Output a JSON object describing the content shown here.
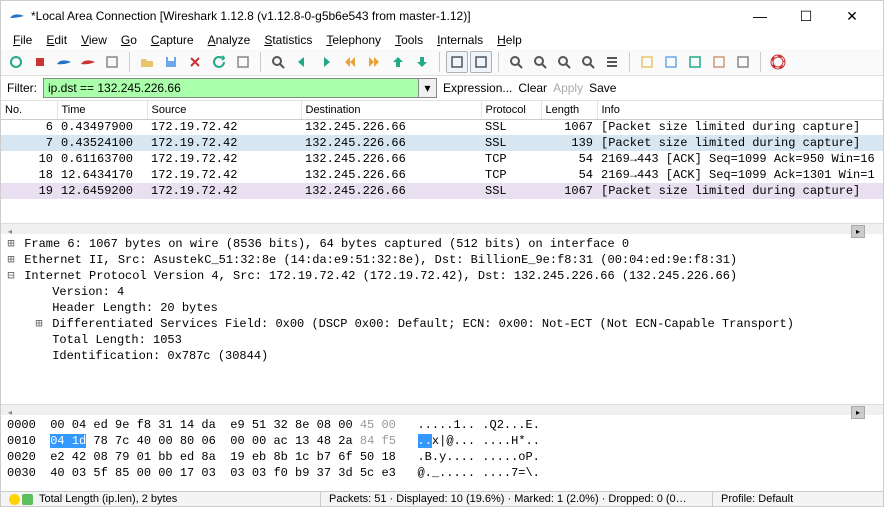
{
  "window": {
    "title": "*Local Area Connection   [Wireshark 1.12.8  (v1.12.8-0-g5b6e543 from master-1.12)]"
  },
  "menu": [
    "File",
    "Edit",
    "View",
    "Go",
    "Capture",
    "Analyze",
    "Statistics",
    "Telephony",
    "Tools",
    "Internals",
    "Help"
  ],
  "filter": {
    "label": "Filter:",
    "value": "ip.dst == 132.245.226.66",
    "expression": "Expression...",
    "clear": "Clear",
    "apply": "Apply",
    "save": "Save"
  },
  "columns": [
    "No.",
    "Time",
    "Source",
    "Destination",
    "Protocol",
    "Length",
    "Info"
  ],
  "packets": [
    {
      "no": "6",
      "time": "0.43497900",
      "src": "172.19.72.42",
      "dst": "132.245.226.66",
      "proto": "SSL",
      "len": "1067",
      "info": "[Packet size limited during capture]",
      "selected": false,
      "marked": false
    },
    {
      "no": "7",
      "time": "0.43524100",
      "src": "172.19.72.42",
      "dst": "132.245.226.66",
      "proto": "SSL",
      "len": "139",
      "info": "[Packet size limited during capture]",
      "selected": true,
      "marked": true
    },
    {
      "no": "10",
      "time": "0.61163700",
      "src": "172.19.72.42",
      "dst": "132.245.226.66",
      "proto": "TCP",
      "len": "54",
      "info": "2169→443 [ACK] Seq=1099 Ack=950 Win=16",
      "selected": false,
      "marked": false
    },
    {
      "no": "18",
      "time": "12.6434170",
      "src": "172.19.72.42",
      "dst": "132.245.226.66",
      "proto": "TCP",
      "len": "54",
      "info": "2169→443 [ACK] Seq=1099 Ack=1301 Win=1",
      "selected": false,
      "marked": false
    },
    {
      "no": "19",
      "time": "12.6459200",
      "src": "172.19.72.42",
      "dst": "132.245.226.66",
      "proto": "SSL",
      "len": "1067",
      "info": "[Packet size limited during capture]",
      "selected": false,
      "marked": true
    }
  ],
  "details": [
    {
      "exp": "+",
      "ind": 0,
      "text": "Frame 6: 1067 bytes on wire (8536 bits), 64 bytes captured (512 bits) on interface 0"
    },
    {
      "exp": "+",
      "ind": 0,
      "text": "Ethernet II, Src: AsustekC_51:32:8e (14:da:e9:51:32:8e), Dst: BillionE_9e:f8:31 (00:04:ed:9e:f8:31)"
    },
    {
      "exp": "-",
      "ind": 0,
      "text": "Internet Protocol Version 4, Src: 172.19.72.42 (172.19.72.42), Dst: 132.245.226.66 (132.245.226.66)"
    },
    {
      "exp": "",
      "ind": 1,
      "text": "Version: 4"
    },
    {
      "exp": "",
      "ind": 1,
      "text": "Header Length: 20 bytes"
    },
    {
      "exp": "+",
      "ind": 1,
      "text": "Differentiated Services Field: 0x00 (DSCP 0x00: Default; ECN: 0x00: Not-ECT (Not ECN-Capable Transport)"
    },
    {
      "exp": "",
      "ind": 1,
      "text": "Total Length: 1053"
    },
    {
      "exp": "",
      "ind": 1,
      "text": "Identification: 0x787c (30844)"
    }
  ],
  "hex": {
    "lines": [
      {
        "off": "0000",
        "b": "00 04 ed 9e f8 31 14 da  e9 51 32 8e 08 00 ",
        "g": "45 00",
        "a": ".....1.. .Q2...E."
      },
      {
        "off": "0010",
        "hl": "04 1d",
        "b": " 78 7c 40 00 80 06  00 00 ac 13 48 2a ",
        "g": "84 f5",
        "a": "..x|@... ....H*.."
      },
      {
        "off": "0020",
        "b": "e2 42 08 79 01 bb ed 8a  19 eb 8b 1c b7 6f 50 18",
        "g": "",
        "a": ".B.y.... .....oP."
      },
      {
        "off": "0030",
        "b": "40 03 5f 85 00 00 17 03  03 03 f0 b9 37 3d 5c e3",
        "g": "",
        "a": "@._..... ....7=\\."
      }
    ]
  },
  "status": {
    "field": "Total Length (ip.len), 2 bytes",
    "stats": "Packets: 51 · Displayed: 10 (19.6%) · Marked: 1 (2.0%) · Dropped: 0 (0…",
    "profile": "Profile: Default"
  },
  "toolbar_icons": [
    "record",
    "stop",
    "shark",
    "shark-red",
    "preferences",
    "sep",
    "folder",
    "save",
    "close",
    "reload",
    "print",
    "sep",
    "find",
    "back-green",
    "fwd-green",
    "rewind",
    "ffwd",
    "up-arrow",
    "down-arrow",
    "sep",
    "group1",
    "group2",
    "sep",
    "zoom-in",
    "zoom-out",
    "zoom-actual",
    "zoom-fit",
    "resize-cols",
    "sep",
    "chat",
    "filter",
    "checkbox",
    "wrench",
    "gear",
    "sep",
    "help"
  ],
  "icon_colors": {
    "record": "#2a8",
    "stop": "#c33",
    "shark": "#2475c7",
    "shark-red": "#c33",
    "preferences": "#888",
    "folder": "#e9c46a",
    "save": "#6aa8e9",
    "close": "#c33",
    "reload": "#2a8",
    "print": "#888",
    "find": "#555",
    "back-green": "#2a8",
    "fwd-green": "#2a8",
    "rewind": "#e9a23a",
    "ffwd": "#e9a23a",
    "up-arrow": "#2a8",
    "down-arrow": "#2a8",
    "zoom-in": "#555",
    "zoom-out": "#555",
    "zoom-actual": "#555",
    "zoom-fit": "#555",
    "resize-cols": "#555",
    "chat": "#e9c46a",
    "filter": "#6aa8e9",
    "checkbox": "#2a8",
    "wrench": "#c97",
    "gear": "#888",
    "help": "#c33"
  }
}
